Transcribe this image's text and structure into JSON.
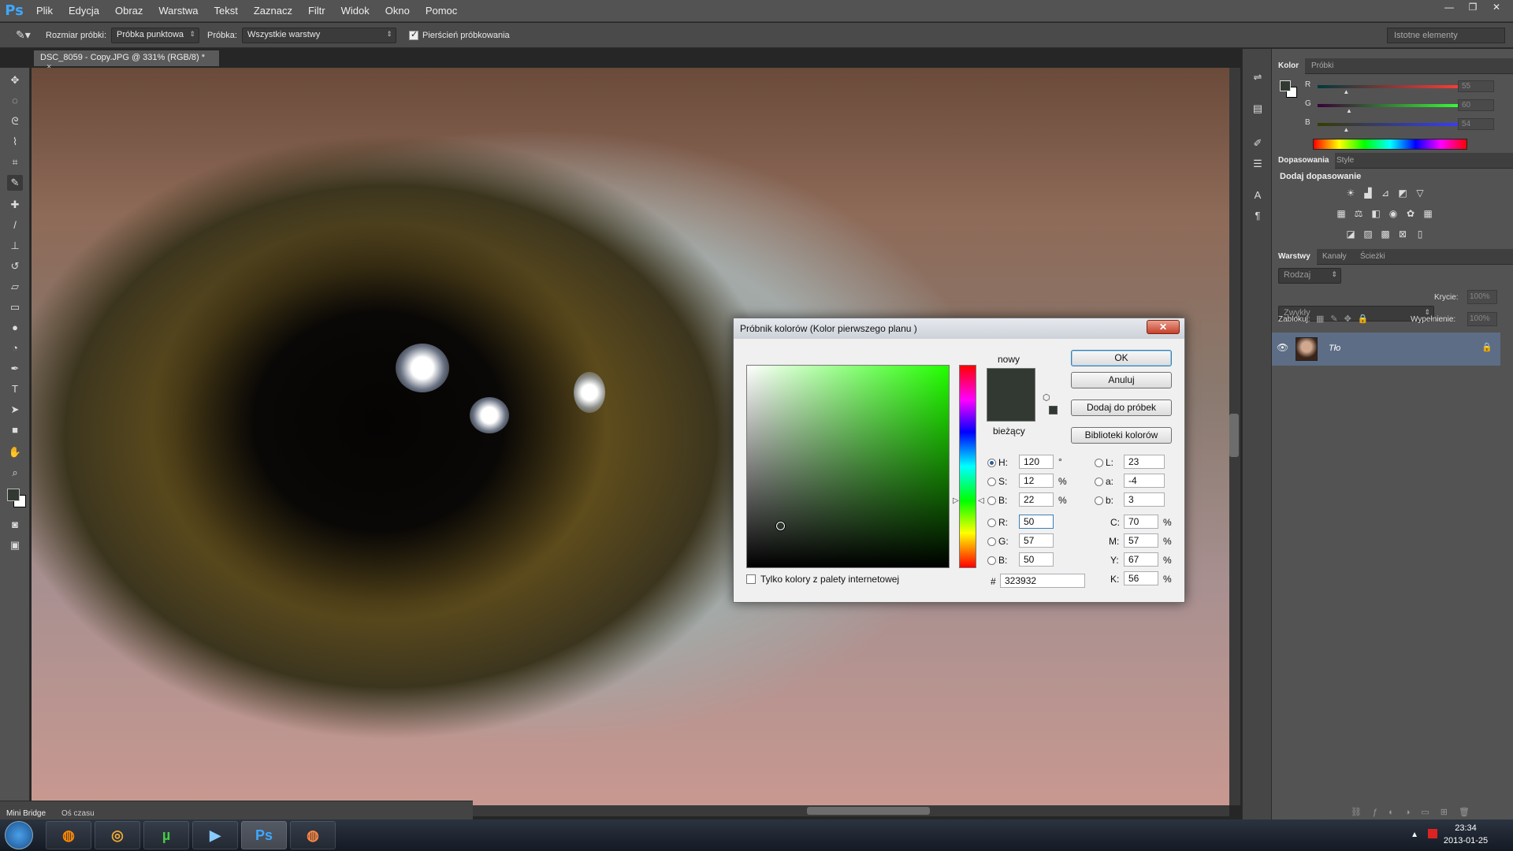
{
  "app": {
    "logo": "Ps",
    "window_controls": [
      "—",
      "❐",
      "✕"
    ]
  },
  "menu": [
    "Plik",
    "Edycja",
    "Obraz",
    "Warstwa",
    "Tekst",
    "Zaznacz",
    "Filtr",
    "Widok",
    "Okno",
    "Pomoc"
  ],
  "options": {
    "tool_icon": "eyedropper-icon",
    "sample_size_label": "Rozmiar próbki:",
    "sample_size_value": "Próbka punktowa",
    "sample_label": "Próbka:",
    "sample_value": "Wszystkie warstwy",
    "ring_label": "Pierścień próbkowania",
    "ring_checked": true,
    "workspace": "Istotne elementy"
  },
  "document": {
    "tab_title": "DSC_8059 - Copy.JPG @ 331% (RGB/8) *",
    "tab_close": "×"
  },
  "panels": {
    "color_tabs": [
      "Kolor",
      "Próbki"
    ],
    "rgb": [
      {
        "label": "R",
        "value": "55",
        "level": 0.2
      },
      {
        "label": "G",
        "value": "60",
        "level": 0.22
      },
      {
        "label": "B",
        "value": "54",
        "level": 0.2
      }
    ],
    "adjust_tabs": [
      "Dopasowania",
      "Style"
    ],
    "adjust_heading": "Dodaj dopasowanie",
    "layers_tabs": [
      "Warstwy",
      "Kanały",
      "Ścieżki"
    ],
    "kind_label": "Rodzaj",
    "blend_mode": "Zwykły",
    "opacity_label": "Krycie:",
    "opacity_value": "100%",
    "lock_label": "Zablokuj:",
    "fill_label": "Wypełnienie:",
    "fill_value": "100%",
    "layer_name": "Tło"
  },
  "minibridge": {
    "tab1": "Mini Bridge",
    "tab2": "Oś czasu"
  },
  "dialog": {
    "title": "Próbnik kolorów (Kolor pierwszego planu )",
    "close": "✕",
    "new_label": "nowy",
    "current_label": "bieżący",
    "buttons": {
      "ok": "OK",
      "cancel": "Anuluj",
      "add_swatch": "Dodaj do próbek",
      "libraries": "Biblioteki kolorów"
    },
    "fields": {
      "H": {
        "label": "H:",
        "value": "120",
        "unit": "°"
      },
      "S": {
        "label": "S:",
        "value": "12",
        "unit": "%"
      },
      "Bv": {
        "label": "B:",
        "value": "22",
        "unit": "%"
      },
      "R": {
        "label": "R:",
        "value": "50"
      },
      "G": {
        "label": "G:",
        "value": "57"
      },
      "B": {
        "label": "B:",
        "value": "50"
      },
      "L": {
        "label": "L:",
        "value": "23"
      },
      "a": {
        "label": "a:",
        "value": "-4"
      },
      "b": {
        "label": "b:",
        "value": "3"
      },
      "C": {
        "label": "C:",
        "value": "70",
        "unit": "%"
      },
      "M": {
        "label": "M:",
        "value": "57",
        "unit": "%"
      },
      "Y": {
        "label": "Y:",
        "value": "67",
        "unit": "%"
      },
      "K": {
        "label": "K:",
        "value": "56",
        "unit": "%"
      }
    },
    "hex_label": "#",
    "hex_value": "323932",
    "web_only_label": "Tylko kolory z palety internetowej",
    "color": "#323932"
  },
  "taskbar": {
    "time": "23:34",
    "date": "2013-01-25"
  }
}
